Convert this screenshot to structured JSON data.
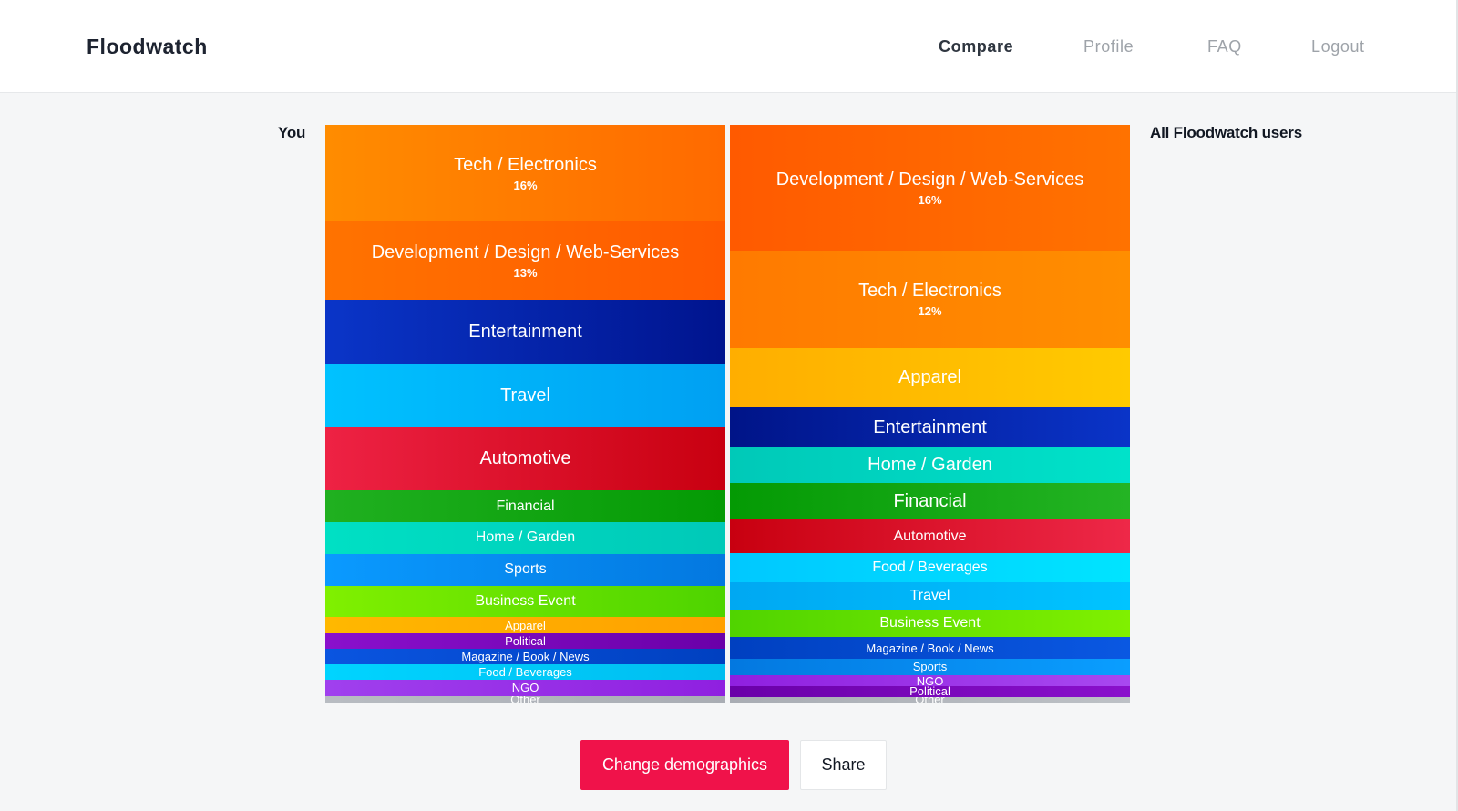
{
  "header": {
    "brand": "Floodwatch",
    "nav": [
      "Compare",
      "Profile",
      "FAQ",
      "Logout"
    ],
    "active_nav": "Compare"
  },
  "labels": {
    "left": "You",
    "right": "All Floodwatch users"
  },
  "chart_data": [
    {
      "type": "stacked-bar",
      "series_label": "You",
      "segments": [
        {
          "name": "Tech / Electronics",
          "pct": "16%",
          "share": 16.0,
          "colors": [
            "#ff8c00",
            "#ff6a00"
          ],
          "size": "xl"
        },
        {
          "name": "Development / Design / Web-Services",
          "pct": "13%",
          "share": 13.0,
          "colors": [
            "#ff7300",
            "#ff5a00"
          ],
          "size": "xl"
        },
        {
          "name": "Entertainment",
          "pct": "",
          "share": 10.5,
          "colors": [
            "#0a35c8",
            "#00148e"
          ],
          "size": "lg"
        },
        {
          "name": "Travel",
          "pct": "",
          "share": 10.5,
          "colors": [
            "#00c2ff",
            "#00a0f2"
          ],
          "size": "lg"
        },
        {
          "name": "Automotive",
          "pct": "",
          "share": 10.5,
          "colors": [
            "#ee2244",
            "#c80010"
          ],
          "size": "lg"
        },
        {
          "name": "Financial",
          "pct": "",
          "share": 5.25,
          "colors": [
            "#20b020",
            "#049a04"
          ],
          "size": "md"
        },
        {
          "name": "Home / Garden",
          "pct": "",
          "share": 5.25,
          "colors": [
            "#00e0c4",
            "#00c9b8"
          ],
          "size": "md"
        },
        {
          "name": "Sports",
          "pct": "",
          "share": 5.25,
          "colors": [
            "#0a9aff",
            "#0378e0"
          ],
          "size": "md"
        },
        {
          "name": "Business Event",
          "pct": "",
          "share": 5.25,
          "colors": [
            "#80f000",
            "#4ed400"
          ],
          "size": "md"
        },
        {
          "name": "Apparel",
          "pct": "",
          "share": 2.6,
          "colors": [
            "#ffb800",
            "#ffa000"
          ],
          "size": "sm"
        },
        {
          "name": "Political",
          "pct": "",
          "share": 2.6,
          "colors": [
            "#8a10cc",
            "#6a00a8"
          ],
          "size": "sm"
        },
        {
          "name": "Magazine / Book / News",
          "pct": "",
          "share": 2.6,
          "colors": [
            "#0a55e0",
            "#0040c0"
          ],
          "size": "sm"
        },
        {
          "name": "Food / Beverages",
          "pct": "",
          "share": 2.6,
          "colors": [
            "#00d4ff",
            "#00bdf0"
          ],
          "size": "sm"
        },
        {
          "name": "NGO",
          "pct": "",
          "share": 2.6,
          "colors": [
            "#a040ee",
            "#8f20e0"
          ],
          "size": "sm"
        },
        {
          "name": "Other",
          "pct": "",
          "share": 1.1,
          "colors": [
            "#b8bcc2",
            "#a9adb4"
          ],
          "size": "sm"
        }
      ]
    },
    {
      "type": "stacked-bar",
      "series_label": "All Floodwatch users",
      "segments": [
        {
          "name": "Development / Design / Web-Services",
          "pct": "16%",
          "share": 21.8,
          "colors": [
            "#ff5a00",
            "#ff7200"
          ],
          "size": "xl"
        },
        {
          "name": "Tech / Electronics",
          "pct": "12%",
          "share": 16.9,
          "colors": [
            "#ff7a00",
            "#ff8e00"
          ],
          "size": "xl"
        },
        {
          "name": "Apparel",
          "pct": "",
          "share": 10.2,
          "colors": [
            "#ffae00",
            "#ffca00"
          ],
          "size": "lg"
        },
        {
          "name": "Entertainment",
          "pct": "",
          "share": 6.9,
          "colors": [
            "#001488",
            "#0a34c8"
          ],
          "size": "lg"
        },
        {
          "name": "Home / Garden",
          "pct": "",
          "share": 6.3,
          "colors": [
            "#00c9b8",
            "#00e2ca"
          ],
          "size": "lg"
        },
        {
          "name": "Financial",
          "pct": "",
          "share": 6.3,
          "colors": [
            "#049a04",
            "#24b424"
          ],
          "size": "lg"
        },
        {
          "name": "Automotive",
          "pct": "",
          "share": 5.8,
          "colors": [
            "#c80010",
            "#ee2848"
          ],
          "size": "md"
        },
        {
          "name": "Food / Beverages",
          "pct": "",
          "share": 5.0,
          "colors": [
            "#00c8ff",
            "#00e4ff"
          ],
          "size": "md"
        },
        {
          "name": "Travel",
          "pct": "",
          "share": 4.8,
          "colors": [
            "#00a8f2",
            "#00c4ff"
          ],
          "size": "md"
        },
        {
          "name": "Business Event",
          "pct": "",
          "share": 4.8,
          "colors": [
            "#50d400",
            "#80f000"
          ],
          "size": "md"
        },
        {
          "name": "Magazine / Book / News",
          "pct": "",
          "share": 3.7,
          "colors": [
            "#0040c0",
            "#0a58e2"
          ],
          "size": "sm"
        },
        {
          "name": "Sports",
          "pct": "",
          "share": 2.9,
          "colors": [
            "#0378e0",
            "#0a9eff"
          ],
          "size": "sm"
        },
        {
          "name": "NGO",
          "pct": "",
          "share": 1.9,
          "colors": [
            "#8f20e0",
            "#a848f0"
          ],
          "size": "sm"
        },
        {
          "name": "Political",
          "pct": "",
          "share": 1.8,
          "colors": [
            "#6a00a8",
            "#8a10cc"
          ],
          "size": "sm"
        },
        {
          "name": "Other",
          "pct": "",
          "share": 1.0,
          "colors": [
            "#a9adb4",
            "#bdc1c6"
          ],
          "size": "sm"
        }
      ]
    }
  ],
  "actions": {
    "primary": "Change demographics",
    "secondary": "Share"
  }
}
